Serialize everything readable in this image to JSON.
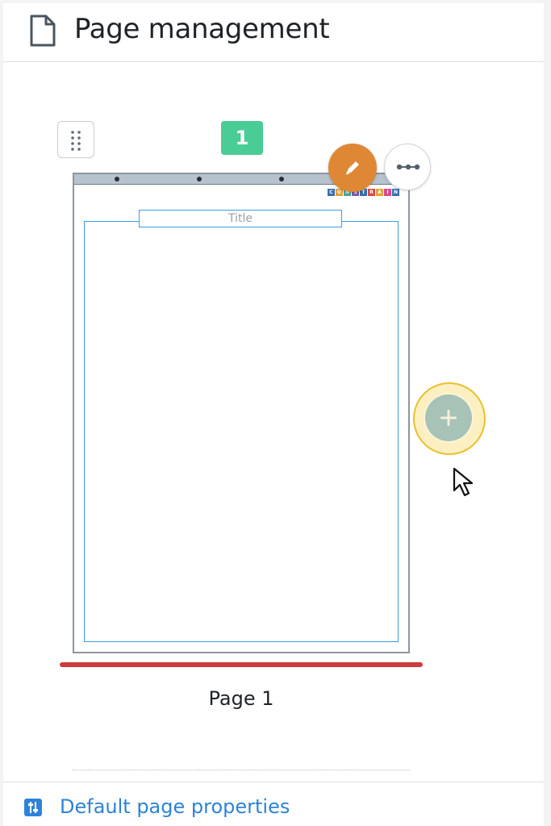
{
  "header": {
    "icon": "page-icon",
    "title": "Page management"
  },
  "page_card": {
    "number_badge": "1",
    "drag_handle_icon": "drag-dots-icon",
    "title_placeholder": "Title",
    "logo_letters": [
      "C",
      "O",
      "N",
      "S",
      "T",
      "R",
      "A",
      "I",
      "N"
    ],
    "edit_icon": "pencil-icon",
    "more_icon": "more-horizontal-icon",
    "label": "Page 1",
    "selected_color": "#cf3a3a",
    "badge_color": "#49cc95"
  },
  "add_page": {
    "icon": "plus-icon",
    "halo_color": "#fcefc2",
    "button_color": "#a7c2b6"
  },
  "footer": {
    "icon": "sliders-icon",
    "link_label": "Default page properties",
    "link_color": "#2d83d6"
  }
}
